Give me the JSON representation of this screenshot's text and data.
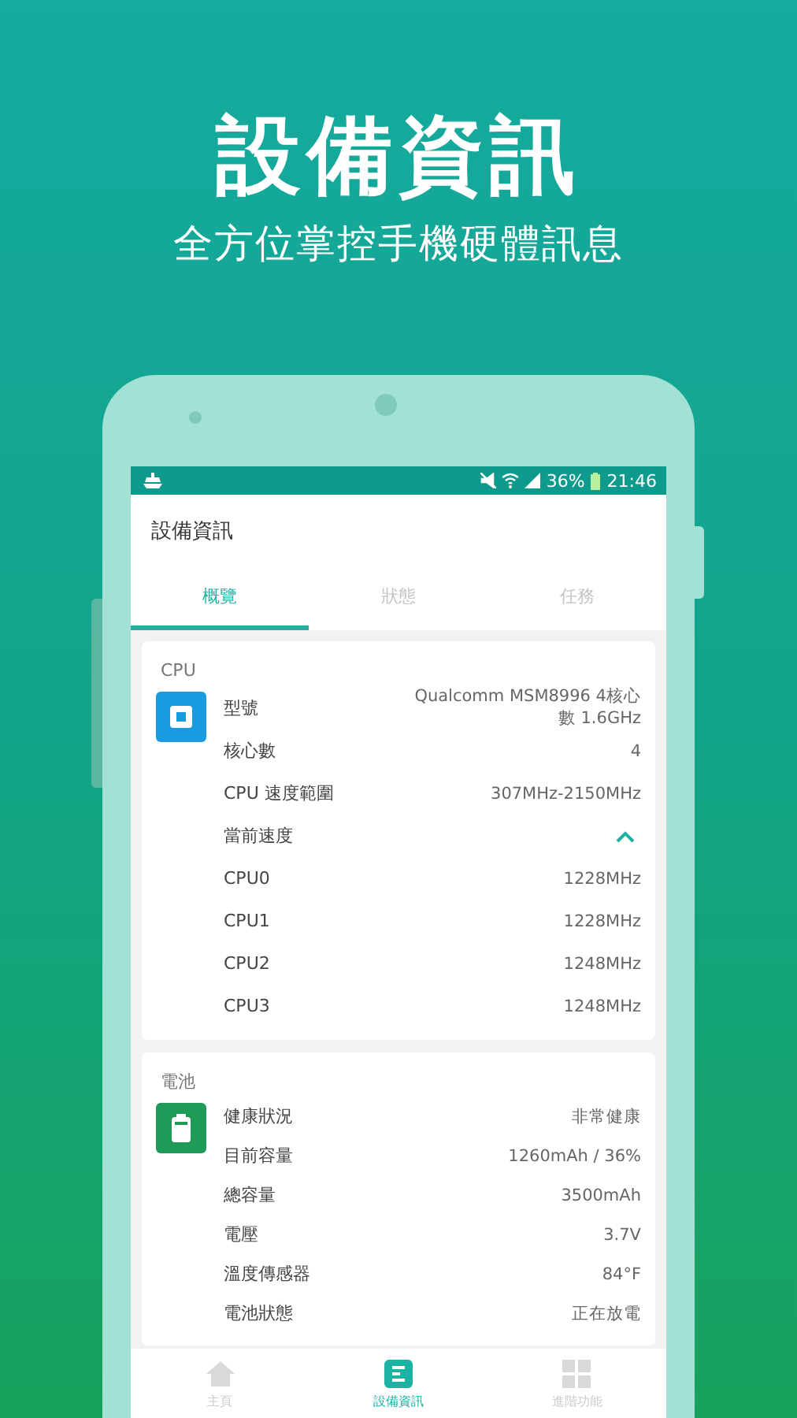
{
  "hero": {
    "title": "設備資訊",
    "subtitle": "全方位掌控手機硬體訊息"
  },
  "status_bar": {
    "battery": "36%",
    "time": "21:46"
  },
  "app_bar": {
    "title": "設備資訊"
  },
  "tabs": [
    {
      "label": "概覽",
      "selected": true
    },
    {
      "label": "狀態",
      "selected": false
    },
    {
      "label": "任務",
      "selected": false
    }
  ],
  "sections": [
    {
      "title": "CPU",
      "rows": [
        {
          "kind": "row",
          "label": "型號",
          "value": "Qualcomm MSM8996 4核心數 1.6GHz"
        },
        {
          "kind": "row",
          "label": "核心數",
          "value": "4"
        },
        {
          "kind": "row",
          "label": "CPU 速度範圍",
          "value": "307MHz-2150MHz"
        },
        {
          "kind": "expander",
          "label": "當前速度",
          "expanded": true
        },
        {
          "kind": "row",
          "label": "CPU0",
          "value": "1228MHz"
        },
        {
          "kind": "row",
          "label": "CPU1",
          "value": "1228MHz"
        },
        {
          "kind": "row",
          "label": "CPU2",
          "value": "1248MHz"
        },
        {
          "kind": "row",
          "label": "CPU3",
          "value": "1248MHz"
        }
      ]
    },
    {
      "title": "電池",
      "rows": [
        {
          "kind": "row",
          "label": "健康狀況",
          "value": "非常健康"
        },
        {
          "kind": "row",
          "label": "目前容量",
          "value": "1260mAh / 36%"
        },
        {
          "kind": "row",
          "label": "總容量",
          "value": "3500mAh"
        },
        {
          "kind": "row",
          "label": "電壓",
          "value": "3.7V"
        },
        {
          "kind": "row",
          "label": "溫度傳感器",
          "value": "84°F"
        },
        {
          "kind": "row",
          "label": "電池狀態",
          "value": "正在放電"
        }
      ]
    }
  ],
  "bottom_nav": [
    {
      "label": "主頁",
      "selected": false
    },
    {
      "label": "設備資訊",
      "selected": true
    },
    {
      "label": "進階功能",
      "selected": false
    }
  ]
}
